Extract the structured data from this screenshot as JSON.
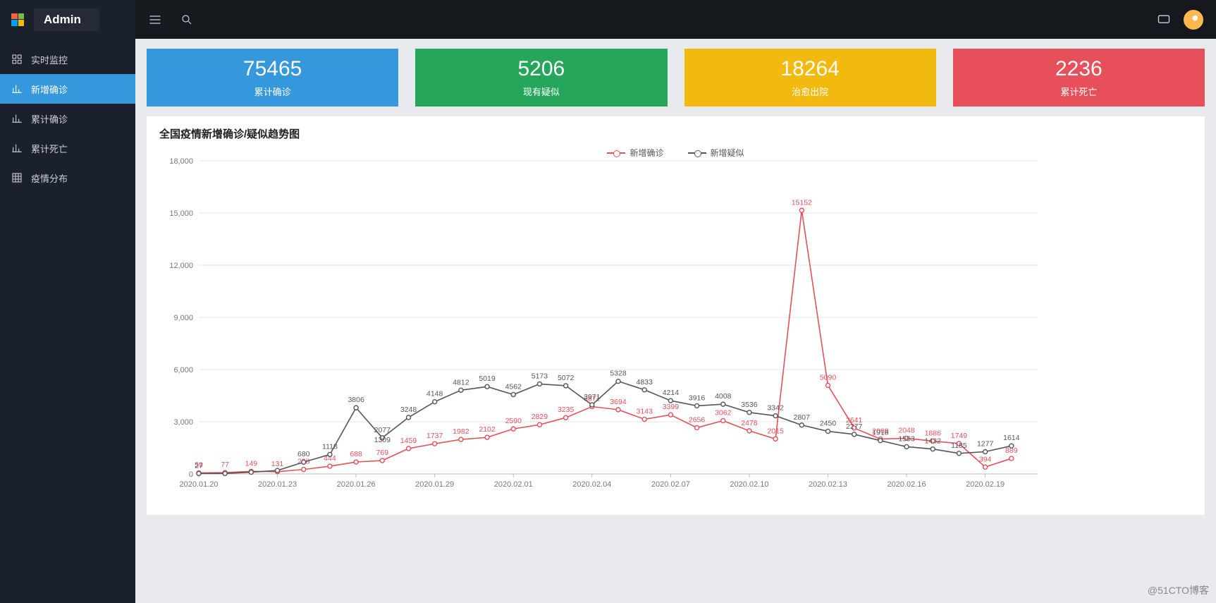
{
  "brand": "Admin",
  "sidebar": {
    "items": [
      {
        "label": "实时监控",
        "icon": "monitor-icon"
      },
      {
        "label": "新增确诊",
        "icon": "bar-chart-icon"
      },
      {
        "label": "累计确诊",
        "icon": "bar-chart-icon"
      },
      {
        "label": "累计死亡",
        "icon": "bar-chart-icon"
      },
      {
        "label": "疫情分布",
        "icon": "grid-icon"
      }
    ],
    "active_index": 1
  },
  "stats": [
    {
      "value": "75465",
      "label": "累计确诊",
      "color": "#3598dc"
    },
    {
      "value": "5206",
      "label": "现有疑似",
      "color": "#26a65b"
    },
    {
      "value": "18264",
      "label": "治愈出院",
      "color": "#f2b90e"
    },
    {
      "value": "2236",
      "label": "累计死亡",
      "color": "#e7505a"
    }
  ],
  "chart_title": "全国疫情新增确诊/疑似趋势图",
  "watermark": "@51CTO博客",
  "chart_data": {
    "type": "line",
    "title": "全国疫情新增确诊/疑似趋势图",
    "xlabel": "",
    "ylabel": "",
    "ylim": [
      0,
      18000
    ],
    "yticks": [
      0,
      3000,
      6000,
      9000,
      12000,
      15000,
      18000
    ],
    "x_tick_labels": [
      "2020.01.20",
      "2020.01.23",
      "2020.01.26",
      "2020.01.29",
      "2020.02.01",
      "2020.02.04",
      "2020.02.07",
      "2020.02.10",
      "2020.02.13",
      "2020.02.16",
      "2020.02.19"
    ],
    "x_tick_indices": [
      0,
      3,
      6,
      9,
      12,
      15,
      18,
      21,
      24,
      27,
      30
    ],
    "categories": [
      "2020.01.20",
      "2020.01.21",
      "2020.01.22",
      "2020.01.23",
      "2020.01.24",
      "2020.01.25",
      "2020.01.26",
      "2020.01.27",
      "2020.01.28",
      "2020.01.29",
      "2020.01.30",
      "2020.01.31",
      "2020.02.01",
      "2020.02.02",
      "2020.02.03",
      "2020.02.04",
      "2020.02.05",
      "2020.02.06",
      "2020.02.07",
      "2020.02.08",
      "2020.02.09",
      "2020.02.10",
      "2020.02.11",
      "2020.02.12",
      "2020.02.13",
      "2020.02.14",
      "2020.02.15",
      "2020.02.16",
      "2020.02.17",
      "2020.02.18",
      "2020.02.19",
      "2020.02.20",
      "2020.02.21"
    ],
    "series": [
      {
        "name": "新增确诊",
        "color": "#e7505a",
        "values": [
          59,
          77,
          149,
          131,
          258,
          444,
          688,
          769,
          1459,
          1737,
          1982,
          2102,
          2590,
          2829,
          3235,
          3871,
          3694,
          3143,
          3399,
          2656,
          3062,
          2478,
          2015,
          15152,
          5090,
          2641,
          2008,
          2048,
          1886,
          1749,
          394,
          889,
          null
        ],
        "labels": [
          {
            "i": 0,
            "t": "59"
          },
          {
            "i": 1,
            "t": "77"
          },
          {
            "i": 2,
            "t": "149"
          },
          {
            "i": 3,
            "t": "131"
          },
          {
            "i": 4,
            "t": "258"
          },
          {
            "i": 5,
            "t": "444"
          },
          {
            "i": 6,
            "t": "688"
          },
          {
            "i": 7,
            "t": "769"
          },
          {
            "i": 8,
            "t": "1459"
          },
          {
            "i": 9,
            "t": "1737"
          },
          {
            "i": 10,
            "t": "1982"
          },
          {
            "i": 11,
            "t": "2102"
          },
          {
            "i": 12,
            "t": "2590"
          },
          {
            "i": 13,
            "t": "2829"
          },
          {
            "i": 14,
            "t": "3235"
          },
          {
            "i": 15,
            "t": "3871"
          },
          {
            "i": 16,
            "t": "3694"
          },
          {
            "i": 17,
            "t": "3143"
          },
          {
            "i": 18,
            "t": "3399"
          },
          {
            "i": 19,
            "t": "2656"
          },
          {
            "i": 20,
            "t": "3062"
          },
          {
            "i": 21,
            "t": "2478"
          },
          {
            "i": 22,
            "t": "2015"
          },
          {
            "i": 23,
            "t": "15152"
          },
          {
            "i": 24,
            "t": "5090"
          },
          {
            "i": 25,
            "t": "2641"
          },
          {
            "i": 26,
            "t": "2008"
          },
          {
            "i": 27,
            "t": "2048"
          },
          {
            "i": 28,
            "t": "1886"
          },
          {
            "i": 29,
            "t": "1749"
          },
          {
            "i": 30,
            "t": "394"
          },
          {
            "i": 31,
            "t": "889"
          }
        ]
      },
      {
        "name": "新增疑似",
        "color": "#555555",
        "values": [
          27,
          27,
          100,
          200,
          680,
          1118,
          3806,
          2077,
          3248,
          4148,
          4812,
          5019,
          4562,
          5173,
          5072,
          3971,
          5328,
          4833,
          4214,
          3916,
          4008,
          3536,
          3342,
          2807,
          2450,
          2277,
          1918,
          1563,
          1432,
          1185,
          1277,
          1614,
          null
        ],
        "labels": [
          {
            "i": 0,
            "t": "27"
          },
          {
            "i": 4,
            "t": "680"
          },
          {
            "i": 5,
            "t": "1118"
          },
          {
            "i": 6,
            "t": "3806"
          },
          {
            "i": 7,
            "t": "2077"
          },
          {
            "i": 8,
            "t": "3248"
          },
          {
            "i": 9,
            "t": "4148"
          },
          {
            "i": 10,
            "t": "4812"
          },
          {
            "i": 11,
            "t": "5019"
          },
          {
            "i": 12,
            "t": "4562"
          },
          {
            "i": 13,
            "t": "5173"
          },
          {
            "i": 14,
            "t": "5072"
          },
          {
            "i": 15,
            "t": "3971"
          },
          {
            "i": 16,
            "t": "5328"
          },
          {
            "i": 17,
            "t": "4833"
          },
          {
            "i": 18,
            "t": "4214"
          },
          {
            "i": 19,
            "t": "3916"
          },
          {
            "i": 20,
            "t": "4008"
          },
          {
            "i": 21,
            "t": "3536"
          },
          {
            "i": 22,
            "t": "3342"
          },
          {
            "i": 23,
            "t": "2807"
          },
          {
            "i": 24,
            "t": "2450"
          },
          {
            "i": 25,
            "t": "2277"
          },
          {
            "i": 26,
            "t": "1918"
          },
          {
            "i": 27,
            "t": "1563"
          },
          {
            "i": 28,
            "t": "1432"
          },
          {
            "i": 29,
            "t": "1185"
          },
          {
            "i": 30,
            "t": "1277"
          },
          {
            "i": 31,
            "t": "1614"
          },
          {
            "i": 7,
            "t": "1309",
            "dy": 14
          }
        ]
      }
    ]
  }
}
